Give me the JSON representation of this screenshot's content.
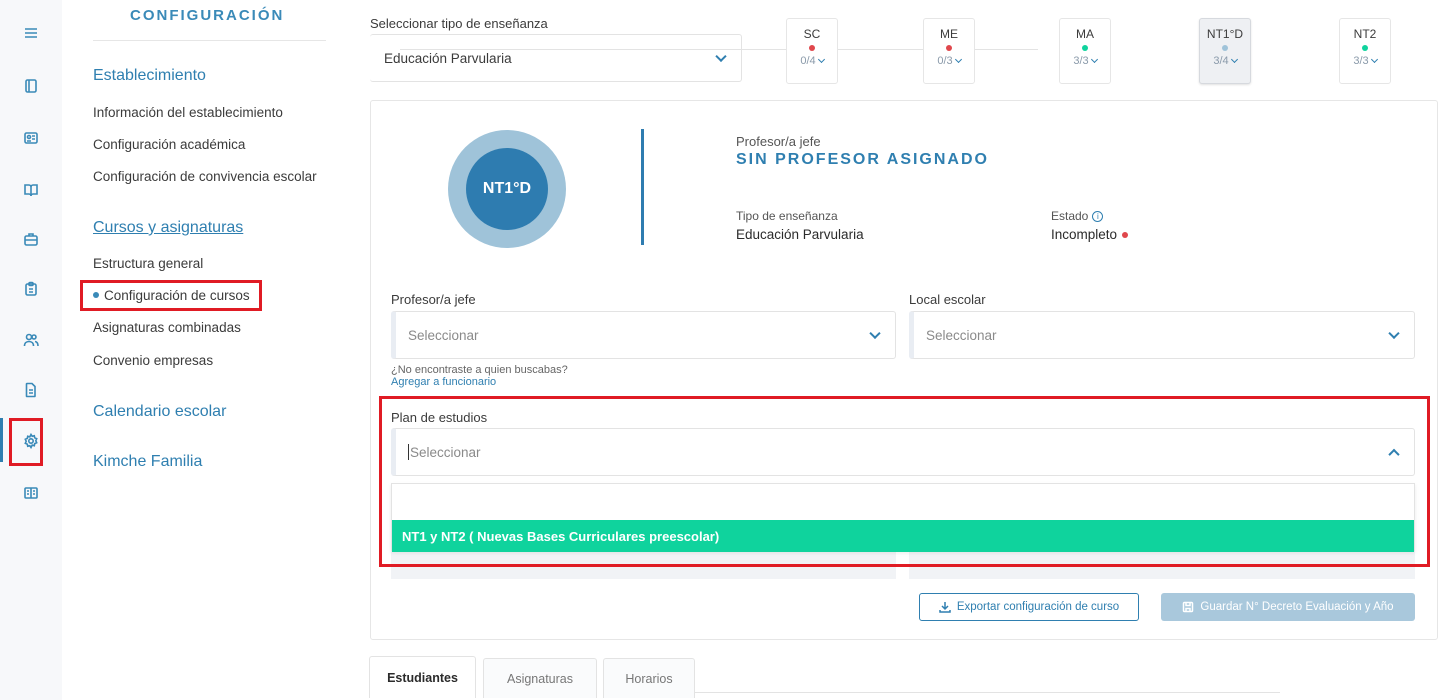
{
  "sidebar": {
    "title": "CONFIGURACIÓN",
    "sections": [
      {
        "label": "Establecimiento"
      },
      {
        "label": "Cursos y asignaturas"
      },
      {
        "label": "Calendario escolar"
      },
      {
        "label": "Kimche Familia"
      }
    ],
    "items": [
      {
        "label": "Información del establecimiento"
      },
      {
        "label": "Configuración académica"
      },
      {
        "label": "Configuración de convivencia escolar"
      },
      {
        "label": "Estructura general"
      },
      {
        "label": "Configuración de cursos"
      },
      {
        "label": "Asignaturas combinadas"
      },
      {
        "label": "Convenio empresas"
      }
    ]
  },
  "rail_icons": [
    "menu-icon",
    "book-icon",
    "id-card-icon",
    "open-book-icon",
    "briefcase-icon",
    "clipboard-icon",
    "users-icon",
    "document-icon",
    "gear-icon",
    "reader-icon"
  ],
  "header": {
    "type_label": "Seleccionar tipo de enseñanza",
    "type_value": "Educación Parvularia",
    "courses": [
      {
        "name": "SC",
        "progress": "0/4",
        "status_color": "#e0474c"
      },
      {
        "name": "ME",
        "progress": "0/3",
        "status_color": "#e0474c"
      },
      {
        "name": "MA",
        "progress": "3/3",
        "status_color": "#0fd39d"
      },
      {
        "name": "NT1°D",
        "progress": "3/4",
        "status_color": "#9fc3d9"
      },
      {
        "name": "NT2",
        "progress": "3/3",
        "status_color": "#0fd39d"
      }
    ]
  },
  "card": {
    "badge": "NT1°D",
    "teacher_label": "Profesor/a jefe",
    "teacher_value": "SIN PROFESOR ASIGNADO",
    "type_label": "Tipo de enseñanza",
    "type_value": "Educación Parvularia",
    "state_label": "Estado",
    "state_value": "Incompleto",
    "info_glyph": "i",
    "form": {
      "teacher_label": "Profesor/a jefe",
      "teacher_placeholder": "Seleccionar",
      "local_label": "Local escolar",
      "local_placeholder": "Seleccionar",
      "hint": "¿No encontraste a quien buscabas?",
      "hint_link": "Agregar a funcionario",
      "plan_label": "Plan de estudios",
      "plan_placeholder": "Seleccionar",
      "plan_option": "NT1 y NT2 ( Nuevas Bases Curriculares preescolar)"
    },
    "export_button": "Exportar configuración de curso",
    "save_button": "Guardar N° Decreto Evaluación y Año"
  },
  "tabs": [
    {
      "label": "Estudiantes"
    },
    {
      "label": "Asignaturas"
    },
    {
      "label": "Horarios"
    }
  ],
  "colors": {
    "accent": "#2f7fb0",
    "success": "#0fd39d",
    "danger": "#e0474c",
    "highlight_box": "#e01b24"
  }
}
